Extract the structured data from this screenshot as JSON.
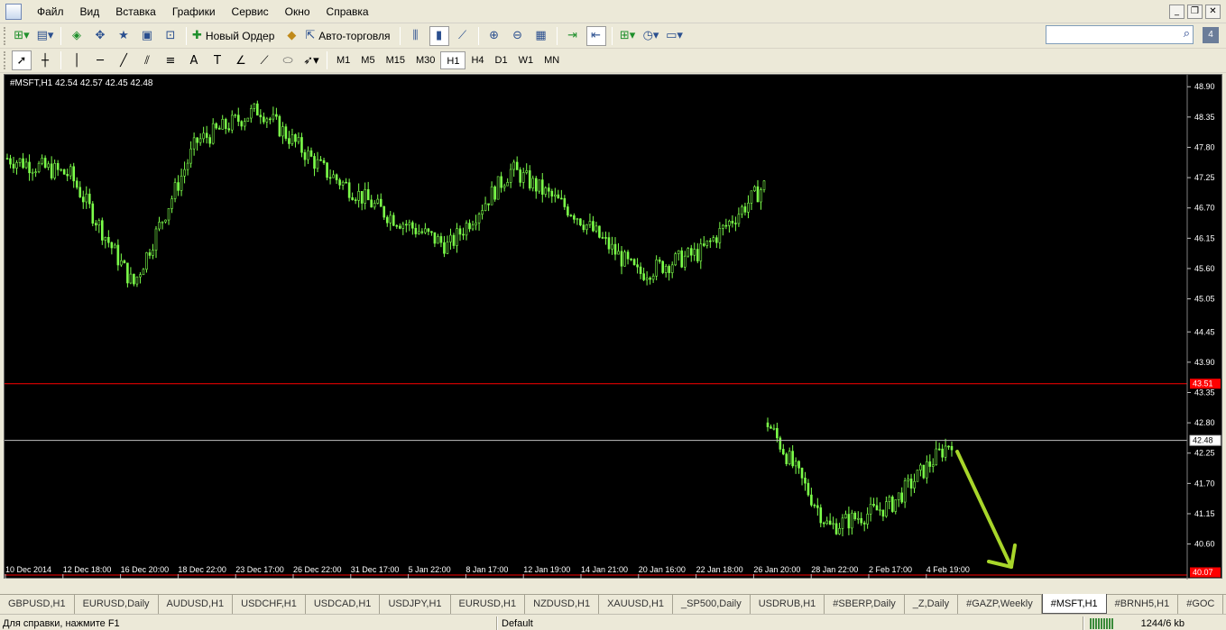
{
  "menubar": {
    "items": [
      "Файл",
      "Вид",
      "Вставка",
      "Графики",
      "Сервис",
      "Окно",
      "Справка"
    ],
    "icons": [
      "minimize-icon",
      "restore-icon",
      "close-icon"
    ]
  },
  "toolbar": {
    "new_order_label": "Новый Ордер",
    "autotrade_label": "Авто-торговля",
    "timeframes": [
      "M1",
      "M5",
      "M15",
      "M30",
      "H1",
      "H4",
      "D1",
      "W1",
      "MN"
    ],
    "selected_timeframe": "H1",
    "search_placeholder": "",
    "badge": "4"
  },
  "chart": {
    "header": "#MSFT,H1  42.54 42.57 42.45 42.48",
    "price_labels": [
      "48.90",
      "48.35",
      "47.80",
      "47.25",
      "46.70",
      "46.15",
      "45.60",
      "45.05",
      "44.45",
      "43.90",
      "43.35",
      "42.80",
      "42.25",
      "41.70",
      "41.15",
      "40.60"
    ],
    "time_labels": [
      "10 Dec 2014",
      "12 Dec 18:00",
      "16 Dec 20:00",
      "18 Dec 22:00",
      "23 Dec 17:00",
      "26 Dec 22:00",
      "31 Dec 17:00",
      "5 Jan 22:00",
      "8 Jan 17:00",
      "12 Jan 19:00",
      "14 Jan 21:00",
      "20 Jan 16:00",
      "22 Jan 18:00",
      "26 Jan 20:00",
      "28 Jan 22:00",
      "2 Feb 17:00",
      "4 Feb 19:00"
    ],
    "current_price": "42.48",
    "red_line_price": "43.51",
    "bottom_red_price": "40.07",
    "colors": {
      "background": "#000000",
      "candles": "#7cff4a",
      "red_line": "#ff0000",
      "bid_line": "#c0c0c0",
      "arrow": "#a8d62a",
      "axis_text": "#ffffff"
    }
  },
  "chart_data": {
    "type": "candlestick",
    "title": "#MSFT,H1",
    "ohlc_header": {
      "open": 42.54,
      "high": 42.57,
      "low": 42.45,
      "close": 42.48
    },
    "ylim": [
      40.07,
      49.1
    ],
    "y_ticks": [
      48.9,
      48.35,
      47.8,
      47.25,
      46.7,
      46.15,
      45.6,
      45.05,
      44.45,
      43.9,
      43.35,
      42.8,
      42.25,
      41.7,
      41.15,
      40.6
    ],
    "x_ticks": [
      "10 Dec 2014",
      "12 Dec 18:00",
      "16 Dec 20:00",
      "18 Dec 22:00",
      "23 Dec 17:00",
      "26 Dec 22:00",
      "31 Dec 17:00",
      "5 Jan 22:00",
      "8 Jan 17:00",
      "12 Jan 19:00",
      "14 Jan 21:00",
      "20 Jan 16:00",
      "22 Jan 18:00",
      "26 Jan 20:00",
      "28 Jan 22:00",
      "2 Feb 17:00",
      "4 Feb 19:00"
    ],
    "close_path": [
      {
        "x": "10 Dec 2014",
        "y": 47.6
      },
      {
        "x": "12 Dec 18:00",
        "y": 47.3
      },
      {
        "x": "16 Dec 20:00",
        "y": 45.3
      },
      {
        "x": "18 Dec 22:00",
        "y": 47.9
      },
      {
        "x": "23 Dec 17:00",
        "y": 48.5
      },
      {
        "x": "26 Dec 22:00",
        "y": 47.4
      },
      {
        "x": "31 Dec 17:00",
        "y": 46.6
      },
      {
        "x": "5 Jan 22:00",
        "y": 46.0
      },
      {
        "x": "8 Jan 17:00",
        "y": 47.4
      },
      {
        "x": "12 Jan 19:00",
        "y": 46.6
      },
      {
        "x": "14 Jan 21:00",
        "y": 45.5
      },
      {
        "x": "20 Jan 16:00",
        "y": 45.9
      },
      {
        "x": "22 Jan 18:00",
        "y": 47.1
      },
      {
        "x": "26 Jan 20:00",
        "y": 42.8
      },
      {
        "x": "28 Jan 22:00",
        "y": 40.9
      },
      {
        "x": "2 Feb 17:00",
        "y": 41.3
      },
      {
        "x": "4 Feb 19:00",
        "y": 42.48
      }
    ],
    "horizontal_lines": [
      43.51,
      42.48
    ],
    "grid": false
  },
  "tabs": [
    "GBPUSD,H1",
    "EURUSD,Daily",
    "AUDUSD,H1",
    "USDCHF,H1",
    "USDCAD,H1",
    "USDJPY,H1",
    "EURUSD,H1",
    "NZDUSD,H1",
    "XAUUSD,H1",
    "_SP500,Daily",
    "USDRUB,H1",
    "#SBERP,Daily",
    "_Z,Daily",
    "#GAZP,Weekly",
    "#MSFT,H1",
    "#BRNH5,H1",
    "#GOC"
  ],
  "active_tab": "#MSFT,H1",
  "status": {
    "help": "Для справки, нажмите F1",
    "profile": "Default",
    "traffic": "1244/6 kb"
  }
}
